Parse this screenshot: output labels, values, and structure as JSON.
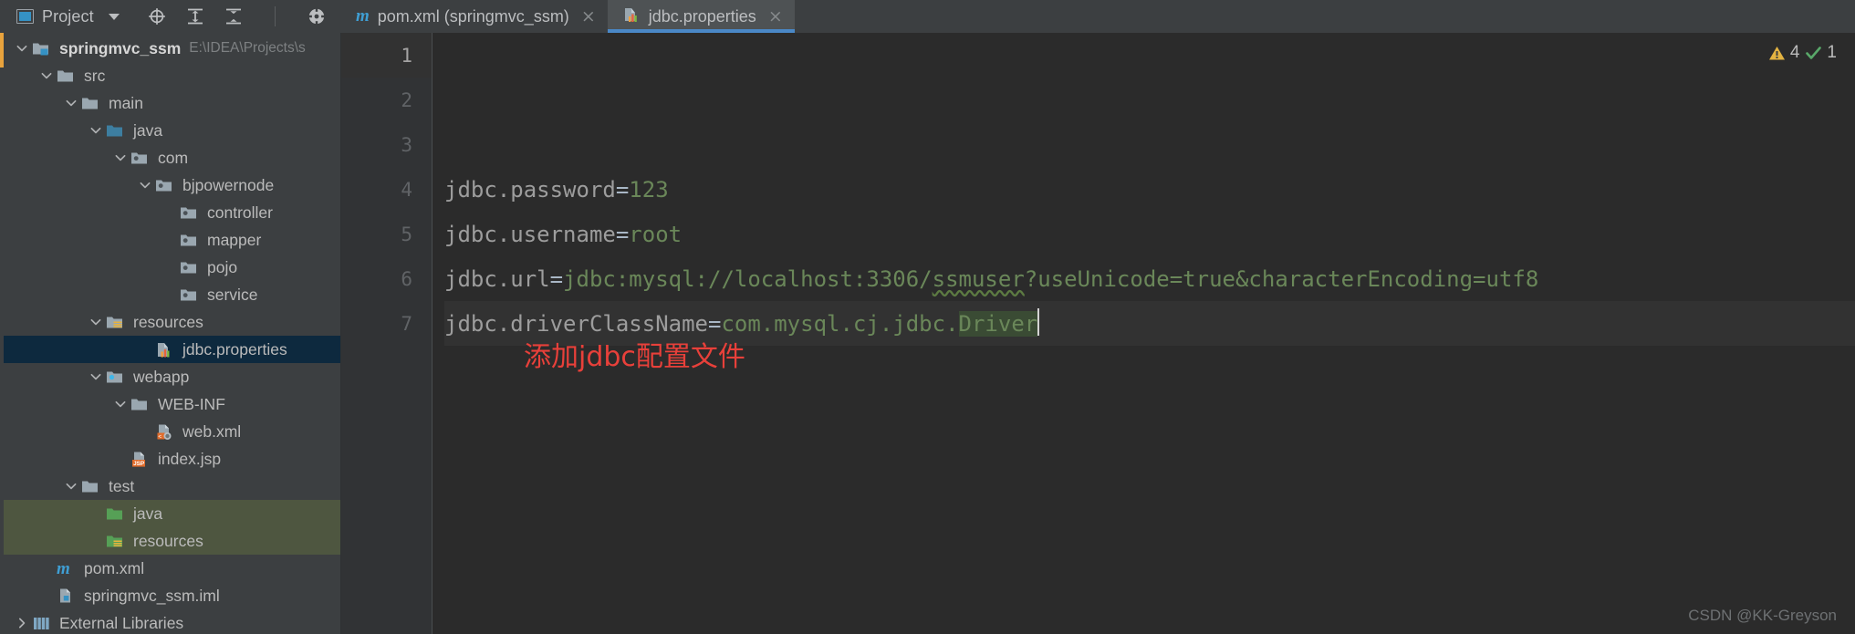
{
  "toolbar": {
    "project_label": "Project",
    "icons": [
      {
        "name": "locate-icon",
        "glyph": "target"
      },
      {
        "name": "expand-all-icon",
        "glyph": "expand"
      },
      {
        "name": "collapse-all-icon",
        "glyph": "collapse"
      },
      {
        "name": "settings-gear-icon",
        "glyph": "gear"
      },
      {
        "name": "hide-icon",
        "glyph": "minus"
      }
    ]
  },
  "tabs": [
    {
      "name": "tab-pom-xml",
      "label": "pom.xml (springmvc_ssm)",
      "icon": "maven-m-icon",
      "active": false,
      "close": "×"
    },
    {
      "name": "tab-jdbc-properties",
      "label": "jdbc.properties",
      "icon": "properties-file-icon",
      "active": true,
      "close": "×"
    }
  ],
  "sidebar": {
    "tree": [
      {
        "label": "springmvc_ssm",
        "path": "E:\\IDEA\\Projects\\s",
        "indent": 0,
        "chevron": "down",
        "icon": "module-folder-icon",
        "bold": true,
        "state": "normal"
      },
      {
        "label": "src",
        "path": "",
        "indent": 1,
        "chevron": "down",
        "icon": "folder-icon",
        "bold": false,
        "state": "normal"
      },
      {
        "label": "main",
        "path": "",
        "indent": 2,
        "chevron": "down",
        "icon": "folder-icon",
        "bold": false,
        "state": "normal"
      },
      {
        "label": "java",
        "path": "",
        "indent": 3,
        "chevron": "down",
        "icon": "source-root-folder-icon",
        "bold": false,
        "state": "normal"
      },
      {
        "label": "com",
        "path": "",
        "indent": 4,
        "chevron": "down",
        "icon": "package-icon",
        "bold": false,
        "state": "normal"
      },
      {
        "label": "bjpowernode",
        "path": "",
        "indent": 5,
        "chevron": "down",
        "icon": "package-icon",
        "bold": false,
        "state": "normal"
      },
      {
        "label": "controller",
        "path": "",
        "indent": 6,
        "chevron": "none",
        "icon": "package-icon",
        "bold": false,
        "state": "normal"
      },
      {
        "label": "mapper",
        "path": "",
        "indent": 6,
        "chevron": "none",
        "icon": "package-icon",
        "bold": false,
        "state": "normal"
      },
      {
        "label": "pojo",
        "path": "",
        "indent": 6,
        "chevron": "none",
        "icon": "package-icon",
        "bold": false,
        "state": "normal"
      },
      {
        "label": "service",
        "path": "",
        "indent": 6,
        "chevron": "none",
        "icon": "package-icon",
        "bold": false,
        "state": "normal"
      },
      {
        "label": "resources",
        "path": "",
        "indent": 3,
        "chevron": "down",
        "icon": "resource-root-folder-icon",
        "bold": false,
        "state": "normal"
      },
      {
        "label": "jdbc.properties",
        "path": "",
        "indent": 5,
        "chevron": "none",
        "icon": "properties-file-icon",
        "bold": false,
        "state": "selected"
      },
      {
        "label": "webapp",
        "path": "",
        "indent": 3,
        "chevron": "down",
        "icon": "web-root-folder-icon",
        "bold": false,
        "state": "normal"
      },
      {
        "label": "WEB-INF",
        "path": "",
        "indent": 4,
        "chevron": "down",
        "icon": "folder-icon",
        "bold": false,
        "state": "normal"
      },
      {
        "label": "web.xml",
        "path": "",
        "indent": 5,
        "chevron": "none",
        "icon": "web-xml-file-icon",
        "bold": false,
        "state": "normal"
      },
      {
        "label": "index.jsp",
        "path": "",
        "indent": 4,
        "chevron": "none",
        "icon": "jsp-file-icon",
        "bold": false,
        "state": "normal"
      },
      {
        "label": "test",
        "path": "",
        "indent": 2,
        "chevron": "down",
        "icon": "folder-icon",
        "bold": false,
        "state": "normal"
      },
      {
        "label": "java",
        "path": "",
        "indent": 3,
        "chevron": "none",
        "icon": "test-source-root-folder-icon",
        "bold": false,
        "state": "testroot"
      },
      {
        "label": "resources",
        "path": "",
        "indent": 3,
        "chevron": "none",
        "icon": "test-resource-root-folder-icon",
        "bold": false,
        "state": "testroot"
      },
      {
        "label": "pom.xml",
        "path": "",
        "indent": 1,
        "chevron": "none",
        "icon": "maven-m-icon",
        "bold": false,
        "state": "normal"
      },
      {
        "label": "springmvc_ssm.iml",
        "path": "",
        "indent": 1,
        "chevron": "none",
        "icon": "iml-file-icon",
        "bold": false,
        "state": "normal"
      },
      {
        "label": "External Libraries",
        "path": "",
        "indent": 0,
        "chevron": "right",
        "icon": "libraries-icon",
        "bold": false,
        "state": "normal"
      }
    ]
  },
  "editor": {
    "line_numbers": [
      "1",
      "2",
      "3",
      "4",
      "5",
      "6",
      "7"
    ],
    "lines": [
      {
        "num": "1",
        "current": true,
        "key": "jdbc.driverClassName",
        "value_plain": "com.mysql.cj.jdbc.",
        "value_hl": "Driver",
        "caret": true
      },
      {
        "num": "2",
        "current": false,
        "key": "jdbc.url",
        "value_pre": "jdbc:mysql://localhost:3306/",
        "value_squiggle": "ssmuser",
        "value_post": "?useUnicode=true&characterEncoding=utf8"
      },
      {
        "num": "3",
        "current": false,
        "key": "jdbc.username",
        "value_plain": "root"
      },
      {
        "num": "4",
        "current": false,
        "key": "jdbc.password",
        "value_plain": "123"
      },
      {
        "num": "5",
        "current": false,
        "key": "",
        "value_plain": ""
      },
      {
        "num": "6",
        "current": false,
        "key": "",
        "value_plain": ""
      },
      {
        "num": "7",
        "current": false,
        "key": "",
        "value_plain": ""
      }
    ],
    "annotation": "添加jdbc配置文件",
    "annotation_color": "#e8403a"
  },
  "inspections": {
    "warning_count": "4",
    "ok_count": "1",
    "warning_color": "#e3b341",
    "ok_color": "#59a869"
  },
  "watermark": "CSDN @KK-Greyson",
  "colors": {
    "sidebar_bg": "#3c3f41",
    "editor_bg": "#2b2b2b",
    "selection_bg": "#0d293e",
    "test_root_bg": "#4e5640",
    "accent_blue": "#4a88c7",
    "value_green": "#6a8759",
    "key_gray": "#9d9d9d"
  }
}
